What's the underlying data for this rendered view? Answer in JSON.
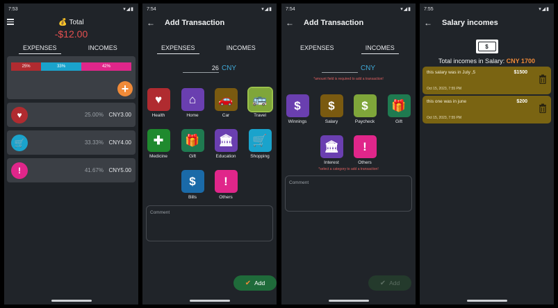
{
  "screen1": {
    "time": "7:53",
    "total_label": "💰 Total",
    "total_value": "-$12.00",
    "tabs": [
      "EXPENSES",
      "INCOMES"
    ],
    "breakdown": [
      {
        "label": "25%",
        "value": 25,
        "color": "#b02b30"
      },
      {
        "label": "33%",
        "value": 33.33,
        "color": "#1aa3cc"
      },
      {
        "label": "42%",
        "value": 41.67,
        "color": "#e0268a"
      }
    ],
    "rows": [
      {
        "icon": "heart-pulse-icon",
        "color": "#b02b30",
        "percent": "25.00%",
        "amount": "CNY3.00"
      },
      {
        "icon": "cart-icon",
        "color": "#1aa3cc",
        "percent": "33.33%",
        "amount": "CNY4.00"
      },
      {
        "icon": "exclamation-icon",
        "color": "#e0268a",
        "percent": "41.67%",
        "amount": "CNY5.00"
      }
    ]
  },
  "screen2": {
    "time": "7:54",
    "title": "Add Transaction",
    "tabs": [
      "EXPENSES",
      "INCOMES"
    ],
    "amount": "26",
    "currency": "CNY",
    "categories": [
      {
        "label": "Health",
        "icon": "heart-pulse-icon",
        "color": "#b02b30",
        "selected": false
      },
      {
        "label": "Home",
        "icon": "home-icon",
        "color": "#6a3fb0",
        "selected": false
      },
      {
        "label": "Car",
        "icon": "car-icon",
        "color": "#7a5a10",
        "selected": false
      },
      {
        "label": "Travel",
        "icon": "bus-icon",
        "color": "#7fa63a",
        "selected": true
      },
      {
        "label": "Medicine",
        "icon": "medicine-icon",
        "color": "#1f8a2e",
        "selected": false
      },
      {
        "label": "Gift",
        "icon": "gift-icon",
        "color": "#1f7a50",
        "selected": false
      },
      {
        "label": "Education",
        "icon": "education-icon",
        "color": "#6a3fb0",
        "selected": false
      },
      {
        "label": "Shopping",
        "icon": "cart-icon",
        "color": "#1aa3cc",
        "selected": false
      },
      {
        "label": "Bills",
        "icon": "money-bill-icon",
        "color": "#1a6aa8",
        "selected": false
      },
      {
        "label": "Others",
        "icon": "exclamation-icon",
        "color": "#e0268a",
        "selected": false
      }
    ],
    "comment_placeholder": "Comment",
    "add_label": "Add"
  },
  "screen3": {
    "time": "7:54",
    "title": "Add Transaction",
    "tabs": [
      "EXPENSES",
      "INCOMES"
    ],
    "amount": "",
    "currency": "CNY",
    "amount_error": "*amount field is required to add a transaction!",
    "categories": [
      {
        "label": "Winnings",
        "icon": "dollar-icon",
        "color": "#6a3fb0"
      },
      {
        "label": "Salary",
        "icon": "money-bill-icon",
        "color": "#7a5a10"
      },
      {
        "label": "Paycheck",
        "icon": "paycheck-icon",
        "color": "#7fa63a"
      },
      {
        "label": "Gift",
        "icon": "gift-icon",
        "color": "#1f7a50"
      },
      {
        "label": "Interest",
        "icon": "bank-icon",
        "color": "#6a3fb0"
      },
      {
        "label": "Others",
        "icon": "exclamation-icon",
        "color": "#e0268a"
      }
    ],
    "category_error": "*select a category to add a transaction!",
    "comment_placeholder": "Comment",
    "add_label": "Add"
  },
  "screen4": {
    "time": "7:55",
    "title": "Salary incomes",
    "total_prefix": "Total incomes in Salary:",
    "total_value": "CNY 1700",
    "items": [
      {
        "comment": "this salary was in July ,5",
        "amount": "$1500",
        "date": "Oct 15, 2023, 7:55 PM"
      },
      {
        "comment": "this one was in june",
        "amount": "$200",
        "date": "Oct 15, 2023, 7:55 PM"
      }
    ]
  },
  "colors": {
    "accent_orange": "#f08a38",
    "currency_blue": "#3fa8d6",
    "error_red": "#e06060",
    "add_green": "#1f6b3a"
  }
}
